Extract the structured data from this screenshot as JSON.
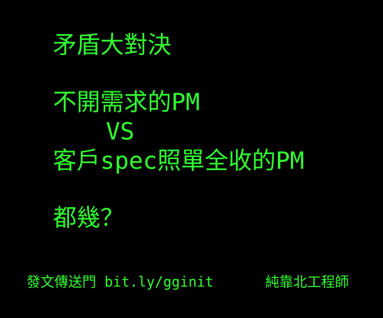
{
  "colors": {
    "background": "#000000",
    "text": "#33ff33"
  },
  "slide": {
    "title": "矛盾大對決",
    "line1": "不開需求的PM",
    "vs": "VS",
    "line2": "客戶spec照單全收的PM",
    "question": "都幾？"
  },
  "footer": {
    "left": "發文傳送門 bit.ly/gginit",
    "right": "純靠北工程師"
  }
}
